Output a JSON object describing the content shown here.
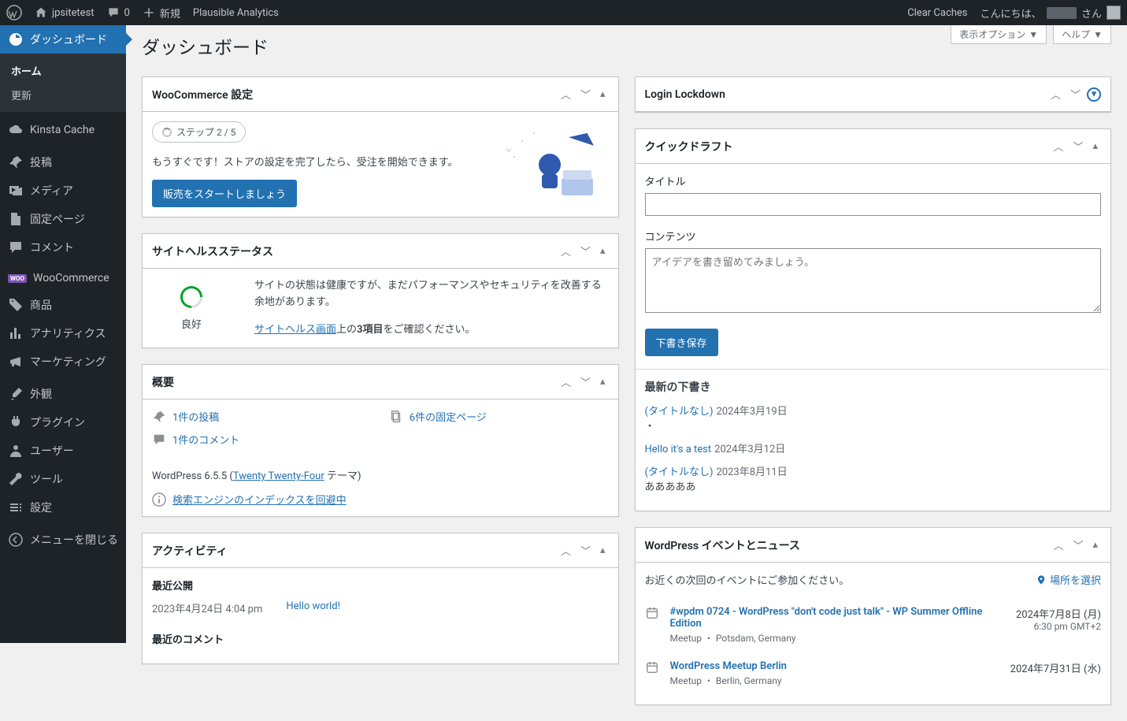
{
  "adminbar": {
    "site_name": "jpsitetest",
    "comments_count": "0",
    "new_label": "新規",
    "plausible": "Plausible Analytics",
    "clear_caches": "Clear Caches",
    "greeting": "こんにちは、",
    "greeting_suffix": "さん"
  },
  "sidebar": {
    "dashboard": "ダッシュボード",
    "home": "ホーム",
    "updates": "更新",
    "kinsta": "Kinsta Cache",
    "posts": "投稿",
    "media": "メディア",
    "pages": "固定ページ",
    "comments": "コメント",
    "woocommerce": "WooCommerce",
    "products": "商品",
    "analytics": "アナリティクス",
    "marketing": "マーケティング",
    "appearance": "外観",
    "plugins": "プラグイン",
    "users": "ユーザー",
    "tools": "ツール",
    "settings": "設定",
    "collapse": "メニューを閉じる"
  },
  "header": {
    "title": "ダッシュボード",
    "screen_options": "表示オプション",
    "help": "ヘルプ"
  },
  "woo_setup": {
    "title": "WooCommerce 設定",
    "step": "ステップ 2 / 5",
    "desc": "もうすぐです！ストアの設定を完了したら、受注を開始できます。",
    "cta": "販売をスタートしましょう"
  },
  "site_health": {
    "title": "サイトヘルスステータス",
    "status": "良好",
    "line1": "サイトの状態は健康ですが、まだパフォーマンスやセキュリティを改善する余地があります。",
    "link": "サイトヘルス画面",
    "line2a": "上の",
    "line2bold": "3項目",
    "line2b": "をご確認ください。"
  },
  "glance": {
    "title": "概要",
    "posts": "1件の投稿",
    "pages": "6件の固定ページ",
    "comments": "1件のコメント",
    "wp_prefix": "WordPress 6.5.5 (",
    "theme": "Twenty Twenty-Four",
    "wp_suffix": " テーマ)",
    "search_engines": "検索エンジンのインデックスを回避中"
  },
  "activity": {
    "title": "アクティビティ",
    "recent_pub": "最近公開",
    "pub_date": "2023年4月24日 4:04 pm",
    "pub_title": "Hello world!",
    "recent_comments": "最近のコメント"
  },
  "login_lockdown": {
    "title": "Login Lockdown"
  },
  "quick_draft": {
    "title": "クイックドラフト",
    "label_title": "タイトル",
    "label_content": "コンテンツ",
    "placeholder": "アイデアを書き留めてみましょう。",
    "save": "下書き保存",
    "recent_drafts": "最新の下書き",
    "drafts": [
      {
        "title": "(タイトルなし)",
        "date": "2024年3月19日",
        "excerpt": "・"
      },
      {
        "title": "Hello it's a test",
        "date": "2024年3月12日",
        "excerpt": ""
      },
      {
        "title": "(タイトルなし)",
        "date": "2023年8月11日",
        "excerpt": "あああああ"
      }
    ]
  },
  "events": {
    "title": "WordPress イベントとニュース",
    "intro": "お近くの次回のイベントにご参加ください。",
    "select_loc": "場所を選択",
    "items": [
      {
        "name": "#wpdm 0724 - WordPress \"don't code just talk\" - WP Summer Offline Edition",
        "meta": "Meetup ・ Potsdam, Germany",
        "date": "2024年7月8日 (月)",
        "time": "6:30 pm GMT+2"
      },
      {
        "name": "WordPress Meetup Berlin",
        "meta": "Meetup ・ Berlin, Germany",
        "date": "2024年7月31日 (水)",
        "time": ""
      }
    ]
  }
}
